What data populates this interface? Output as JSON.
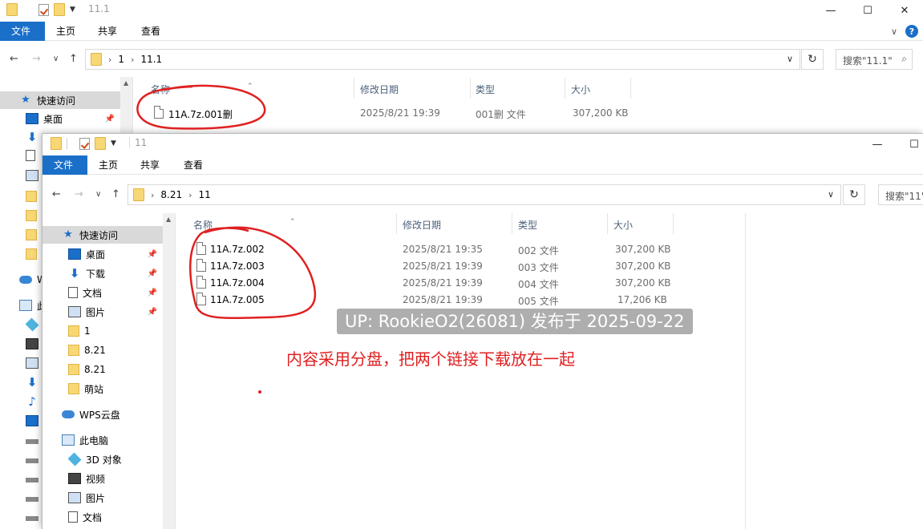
{
  "back_window": {
    "title": "11.1",
    "ribbon_tabs": [
      "文件",
      "主页",
      "共享",
      "查看"
    ],
    "breadcrumb": [
      "1",
      "11.1"
    ],
    "search_placeholder": "搜索\"11.1\"",
    "sidebar": [
      {
        "label": "快速访问",
        "icon": "star-icon"
      },
      {
        "label": "桌面",
        "icon": "desktop-icon",
        "pinned": true
      },
      {
        "label": "W",
        "icon": "cloud-icon"
      },
      {
        "label": "此",
        "icon": "pc-icon"
      }
    ],
    "columns": [
      "名称",
      "修改日期",
      "类型",
      "大小"
    ],
    "files": [
      {
        "name": "11A.7z.001删",
        "modified": "2025/8/21 19:39",
        "type": "001删 文件",
        "size": "307,200 KB"
      }
    ]
  },
  "front_window": {
    "title": "11",
    "ribbon_tabs": [
      "文件",
      "主页",
      "共享",
      "查看"
    ],
    "breadcrumb": [
      "8.21",
      "11"
    ],
    "search_placeholder": "搜索\"11\"",
    "sidebar": [
      {
        "label": "快速访问",
        "icon": "star-icon"
      },
      {
        "label": "桌面",
        "icon": "desktop-icon",
        "pinned": true
      },
      {
        "label": "下载",
        "icon": "download-icon",
        "pinned": true
      },
      {
        "label": "文档",
        "icon": "document-icon",
        "pinned": true
      },
      {
        "label": "图片",
        "icon": "pictures-icon",
        "pinned": true
      },
      {
        "label": "1",
        "icon": "folder-icon"
      },
      {
        "label": "8.21",
        "icon": "folder-icon"
      },
      {
        "label": "8.21",
        "icon": "folder-icon"
      },
      {
        "label": "萌站",
        "icon": "folder-icon"
      },
      {
        "label": "WPS云盘",
        "icon": "cloud-icon"
      },
      {
        "label": "此电脑",
        "icon": "pc-icon"
      },
      {
        "label": "3D 对象",
        "icon": "3d-objects-icon"
      },
      {
        "label": "视频",
        "icon": "video-icon"
      },
      {
        "label": "图片",
        "icon": "pictures-icon"
      },
      {
        "label": "文档",
        "icon": "document-icon"
      }
    ],
    "columns": [
      "名称",
      "修改日期",
      "类型",
      "大小"
    ],
    "files": [
      {
        "name": "11A.7z.002",
        "modified": "2025/8/21 19:35",
        "type": "002 文件",
        "size": "307,200 KB"
      },
      {
        "name": "11A.7z.003",
        "modified": "2025/8/21 19:39",
        "type": "003 文件",
        "size": "307,200 KB"
      },
      {
        "name": "11A.7z.004",
        "modified": "2025/8/21 19:39",
        "type": "004 文件",
        "size": "307,200 KB"
      },
      {
        "name": "11A.7z.005",
        "modified": "2025/8/21 19:39",
        "type": "005 文件",
        "size": "17,206 KB"
      }
    ]
  },
  "overlay": {
    "watermark": "UP: RookieO2(26081) 发布于 2025-09-22",
    "note": "内容采用分盘，把两个链接下载放在一起",
    "annotation_color": "#e02020"
  },
  "colors": {
    "file_tab": "#1a6fc9",
    "selected_sidebar": "#d9d9d9"
  }
}
